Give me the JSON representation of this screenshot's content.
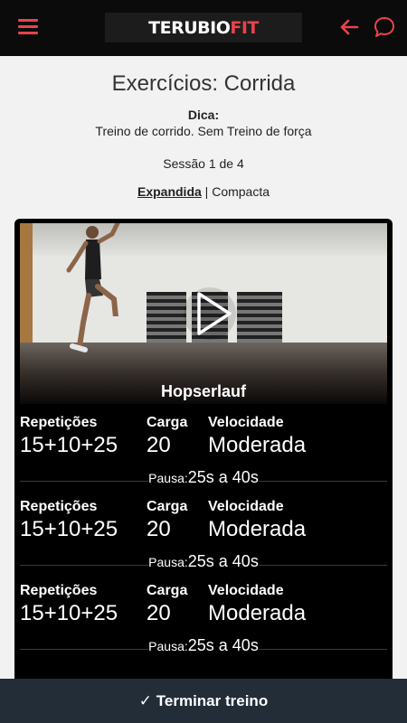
{
  "topbar": {
    "logo_main": "TERUBIO",
    "logo_accent": "FIT",
    "accent_color": "#e8434a",
    "menu_icon": "hamburger-icon",
    "back_icon": "arrow-left-icon",
    "chat_icon": "chat-bubble-icon"
  },
  "header": {
    "title": "Exercícios: Corrida",
    "tip_label": "Dica:",
    "tip_text": "Treino de corrido. Sem Treino de força",
    "session": "Sessão 1 de 4",
    "view_expanded": "Expandida",
    "view_separator": "|",
    "view_compact": "Compacta"
  },
  "exercise": {
    "name": "Hopserlauf",
    "play_icon": "play-icon",
    "sets": [
      {
        "reps_label": "Repetições",
        "reps": "15+10+25",
        "load_label": "Carga",
        "load": "20",
        "speed_label": "Velocidade",
        "speed": "Moderada",
        "pause_label": "Pausa:",
        "pause": "25s a 40s"
      },
      {
        "reps_label": "Repetições",
        "reps": "15+10+25",
        "load_label": "Carga",
        "load": "20",
        "speed_label": "Velocidade",
        "speed": "Moderada",
        "pause_label": "Pausa:",
        "pause": "25s a 40s"
      },
      {
        "reps_label": "Repetições",
        "reps": "15+10+25",
        "load_label": "Carga",
        "load": "20",
        "speed_label": "Velocidade",
        "speed": "Moderada",
        "pause_label": "Pausa:",
        "pause": "25s a 40s"
      }
    ]
  },
  "footer": {
    "finish_label": "✓ Terminar treino"
  }
}
